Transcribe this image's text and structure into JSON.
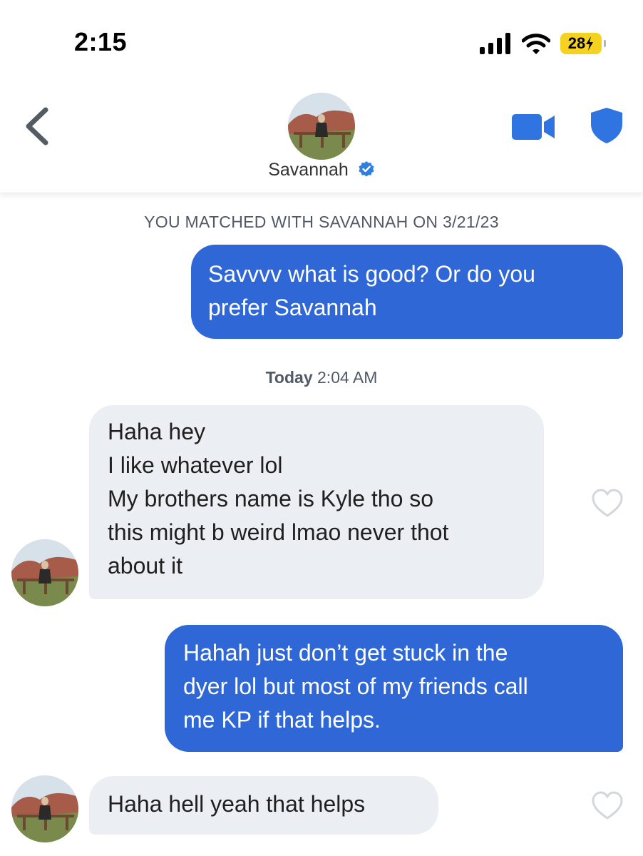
{
  "status_bar": {
    "time": "2:15",
    "battery": "28"
  },
  "header": {
    "contact_name": "Savannah"
  },
  "match_notice": "YOU MATCHED WITH SAVANNAH ON 3/21/23",
  "day_divider": {
    "day": "Today",
    "time": "2:04 AM"
  },
  "messages": [
    {
      "direction": "outgoing",
      "text": "Savvvv what is good? Or do you\nprefer Savannah"
    },
    {
      "direction": "incoming",
      "text": "Haha hey\nI like whatever lol\nMy brothers name is Kyle tho so\nthis might b weird lmao never thot\nabout it"
    },
    {
      "direction": "outgoing",
      "text": "Hahah just don’t get stuck in the\ndyer lol but most of my friends call\nme KP if that helps."
    },
    {
      "direction": "incoming",
      "text": "Haha hell yeah that helps"
    }
  ],
  "colors": {
    "accent_blue": "#2f68d6",
    "incoming_bubble": "#ebeef3",
    "battery_yellow": "#f5d21f"
  },
  "icons": {
    "back": "chevron-left-icon",
    "video": "video-camera-icon",
    "safety": "shield-icon",
    "verified": "verified-badge-icon",
    "like": "heart-outline-icon"
  }
}
